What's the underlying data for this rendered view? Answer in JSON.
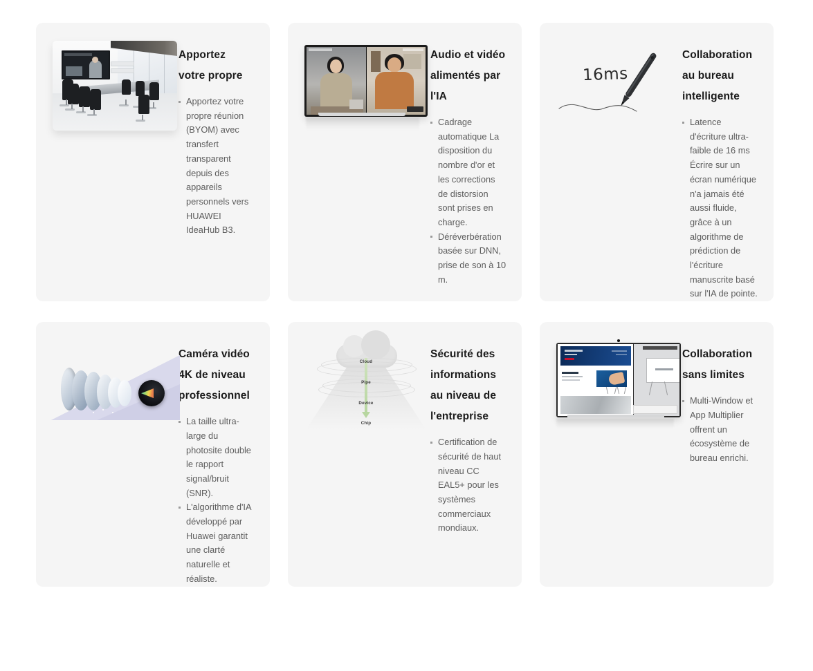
{
  "page": {
    "background_color": "#ffffff",
    "card_background_color": "#f5f5f5",
    "title_color": "#1b1b1b",
    "body_color": "#5d5d5d"
  },
  "cards": [
    {
      "id": "byom",
      "title": "Apportez votre propre",
      "media_name": "conference-room-image",
      "bullets": [
        "Apportez votre propre réunion (BYOM) avec transfert transparent depuis des appareils personnels vers HUAWEI IdeaHub B3."
      ]
    },
    {
      "id": "ai-audio-video",
      "title": "Audio et vidéo alimentés par l'IA",
      "media_name": "video-call-display-image",
      "bullets": [
        "Cadrage automatique La disposition du nombre d'or et les corrections de distorsion sont prises en charge.",
        "Déréverbération basée sur DNN, prise de son à 10 m."
      ]
    },
    {
      "id": "smart-office-collaboration",
      "title": "Collaboration au bureau intelligente",
      "media_name": "stylus-latency-illustration",
      "media_text": "16ms",
      "bullets": [
        "Latence d'écriture ultra-faible de 16 ms Écrire sur un écran numérique n'a jamais été aussi fluide, grâce à un algorithme de prédiction de l'écriture manuscrite basé sur l'IA de pointe."
      ]
    },
    {
      "id": "4k-camera",
      "title": "Caméra vidéo 4K de niveau professionnel",
      "media_name": "camera-lens-stack-image",
      "bullets": [
        "La taille ultra-large du photosite double le rapport signal/bruit (SNR).",
        "L'algorithme d'IA développé par Huawei garantit une clarté naturelle et réaliste."
      ]
    },
    {
      "id": "enterprise-security",
      "title": "Sécurité des informations au niveau de l'entreprise",
      "media_name": "security-layers-diagram",
      "diagram_labels": [
        "Cloud",
        "Pipe",
        "Device",
        "Chip"
      ],
      "bullets": [
        "Certification de sécurité de haut niveau CC EAL5+ pour les systèmes commerciaux mondiaux."
      ]
    },
    {
      "id": "limitless-collaboration",
      "title": "Collaboration sans limites",
      "media_name": "dual-screen-ideahub-image",
      "bullets": [
        "Multi-Window et App Multiplier offrent un écosystème de bureau enrichi."
      ]
    }
  ]
}
